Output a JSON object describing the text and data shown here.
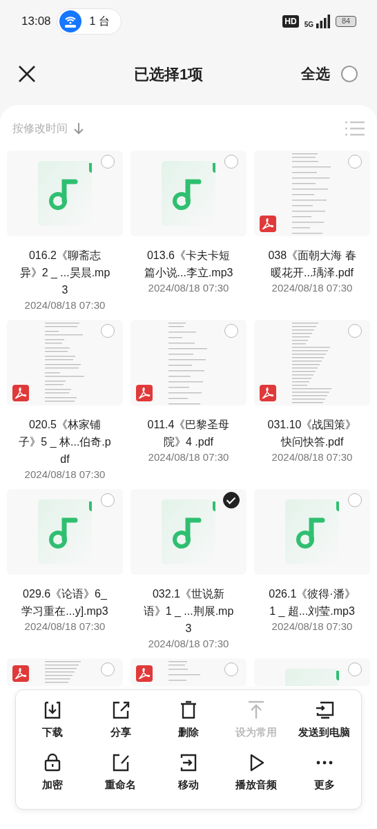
{
  "status_bar": {
    "time": "13:08",
    "hotspot_count": "1 台",
    "hd": "HD",
    "network": "5G",
    "battery": "84"
  },
  "header": {
    "title": "已选择1项",
    "select_all": "全选",
    "all_selected": false
  },
  "sort": {
    "label": "按修改时间"
  },
  "files": [
    {
      "kind": "audio",
      "name": "016.2《聊斋志异》2 _ ...昊晨.mp3",
      "date": "2024/08/18 07:30",
      "selected": false
    },
    {
      "kind": "audio",
      "name": "013.6《卡夫卡短篇小说...李立.mp3",
      "date": "2024/08/18 07:30",
      "selected": false
    },
    {
      "kind": "pdf",
      "name": "038《面朝大海 春暖花开...瑀泽.pdf",
      "date": "2024/08/18 07:30",
      "selected": false
    },
    {
      "kind": "pdf",
      "name": "020.5《林家铺子》5 _ 林...伯奇.pdf",
      "date": "2024/08/18 07:30",
      "selected": false
    },
    {
      "kind": "pdf",
      "name": "011.4《巴黎圣母院》4 .pdf",
      "date": "2024/08/18 07:30",
      "selected": false
    },
    {
      "kind": "pdf",
      "name": "031.10《战国策》快问快答.pdf",
      "date": "2024/08/18 07:30",
      "selected": false
    },
    {
      "kind": "audio",
      "name": "029.6《论语》6_学习重在...y].mp3",
      "date": "2024/08/18 07:30",
      "selected": false
    },
    {
      "kind": "audio",
      "name": "032.1《世说新语》1 _ ...荆展.mp3",
      "date": "2024/08/18 07:30",
      "selected": true
    },
    {
      "kind": "audio",
      "name": "026.1《彼得·潘》1 _ 超...刘莹.mp3",
      "date": "2024/08/18 07:30",
      "selected": false
    },
    {
      "kind": "pdf",
      "selected": false
    },
    {
      "kind": "pdf",
      "selected": false
    },
    {
      "kind": "audio",
      "selected": false
    }
  ],
  "actions": [
    {
      "label": "下载",
      "disabled": false
    },
    {
      "label": "分享",
      "disabled": false
    },
    {
      "label": "删除",
      "disabled": false
    },
    {
      "label": "设为常用",
      "disabled": true
    },
    {
      "label": "发送到电脑",
      "disabled": false
    },
    {
      "label": "加密",
      "disabled": false
    },
    {
      "label": "重命名",
      "disabled": false
    },
    {
      "label": "移动",
      "disabled": false
    },
    {
      "label": "播放音频",
      "disabled": false
    },
    {
      "label": "更多",
      "disabled": false
    }
  ]
}
